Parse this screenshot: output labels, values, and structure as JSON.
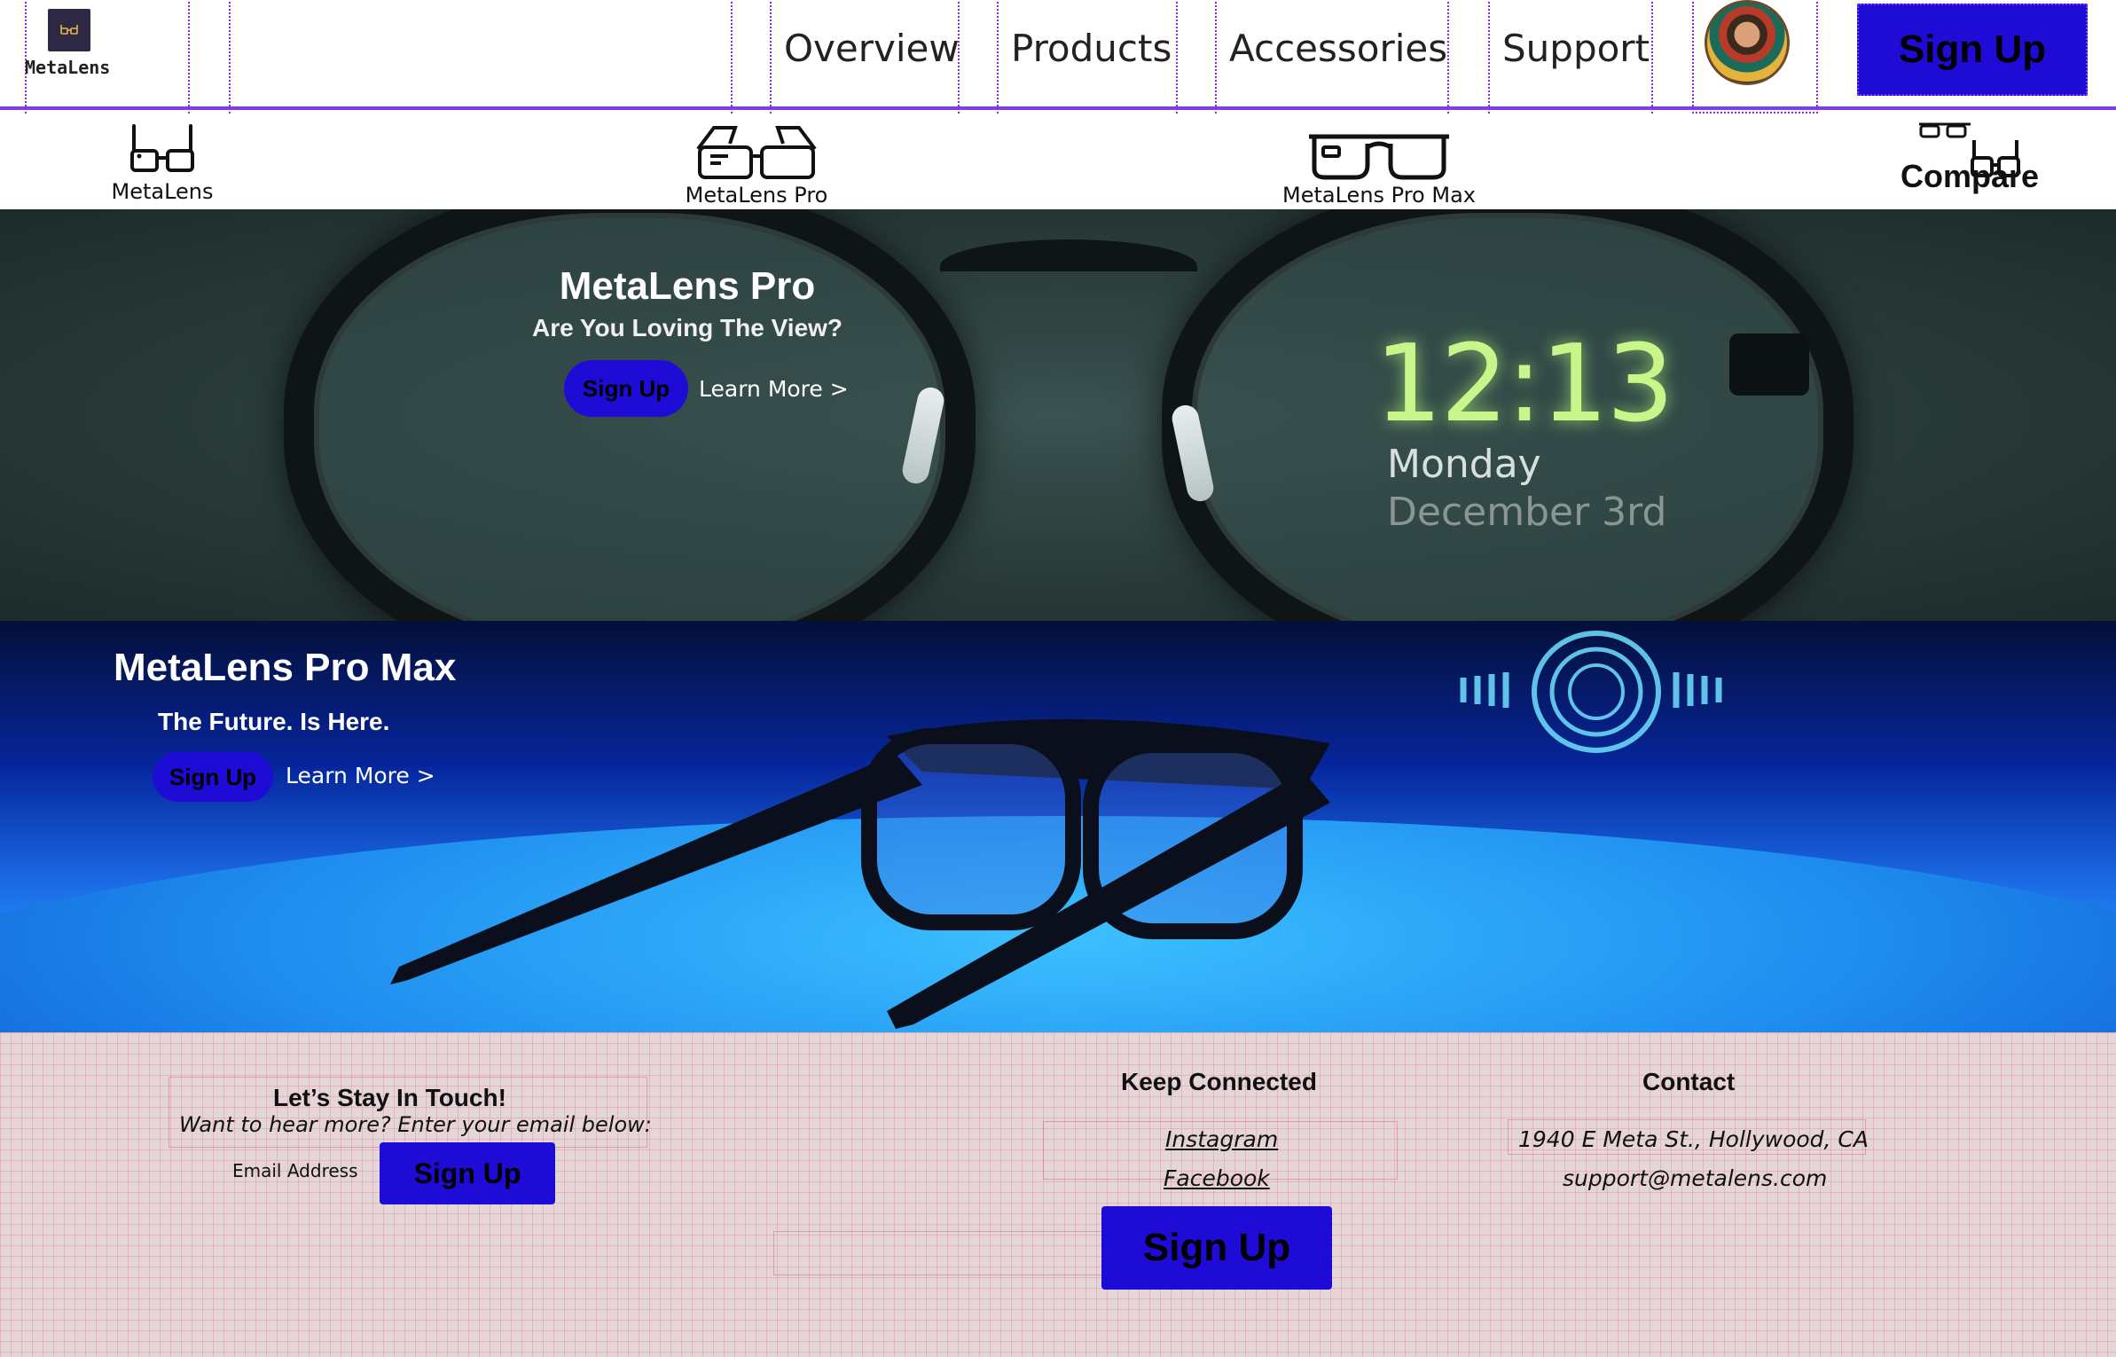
{
  "brand": {
    "name": "MetaLens",
    "logo_icon": "glasses-logo-icon"
  },
  "nav": {
    "links": [
      "Overview",
      "Products",
      "Accessories",
      "Support"
    ],
    "signup_label": "Sign Up",
    "avatar_icon": "user-avatar"
  },
  "products": {
    "items": [
      {
        "label": "MetaLens",
        "icon": "glasses-icon"
      },
      {
        "label": "MetaLens Pro",
        "icon": "smart-glasses-icon"
      },
      {
        "label": "MetaLens Pro Max",
        "icon": "visor-glasses-icon"
      }
    ],
    "compare_label": "Compare"
  },
  "hero_pro": {
    "title": "MetaLens Pro",
    "subtitle": "Are You Loving The View?",
    "signup_label": "Sign Up",
    "learn_more_label": "Learn More >",
    "hud": {
      "time": "12:13",
      "day": "Monday",
      "date": "December 3rd"
    }
  },
  "hero_promax": {
    "title": "MetaLens Pro Max",
    "subtitle": "The Future. Is Here.",
    "signup_label": "Sign Up",
    "learn_more_label": "Learn More >"
  },
  "footer": {
    "touch": {
      "title": "Let’s Stay In Touch!",
      "subtitle": "Want to hear more? Enter your email below:",
      "email_label": "Email Address",
      "signup_label": "Sign Up"
    },
    "connected": {
      "title": "Keep Connected",
      "links": [
        "Instagram",
        "Facebook"
      ],
      "signup_label": "Sign Up"
    },
    "contact": {
      "title": "Contact",
      "address": "1940 E Meta St., Hollywood, CA",
      "email": "support@metalens.com"
    }
  },
  "colors": {
    "accent": "#1e0bd6",
    "nav_border": "#7b3fe4",
    "footer_bg": "#e4d6d8",
    "hud_green": "#c9f58a"
  }
}
